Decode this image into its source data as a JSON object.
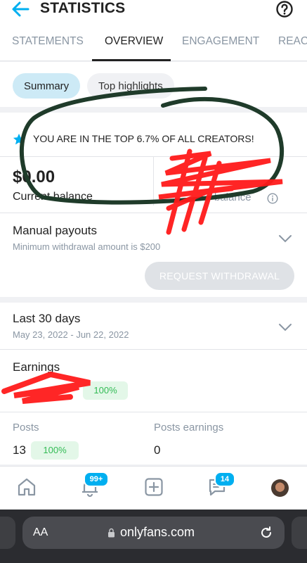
{
  "header": {
    "title": "STATISTICS",
    "back_icon": "arrow-left-icon",
    "help_icon": "question-circle-icon"
  },
  "tabs": [
    {
      "label": "STATEMENTS"
    },
    {
      "label": "OVERVIEW",
      "active": true
    },
    {
      "label": "ENGAGEMENT"
    },
    {
      "label": "REACH"
    }
  ],
  "chips": {
    "summary": "Summary",
    "top_highlights": "Top highlights"
  },
  "highlight": {
    "icon": "star-icon",
    "text": "YOU ARE IN THE TOP 6.7% OF ALL CREATORS!"
  },
  "balance": {
    "amount": "$0.00",
    "label": "Current balance",
    "pending_label": "balance",
    "info_icon": "info-icon"
  },
  "payouts": {
    "title": "Manual payouts",
    "subtitle": "Minimum withdrawal amount is $200",
    "button": "REQUEST WITHDRAWAL"
  },
  "period": {
    "title": "Last 30 days",
    "range": "May 23, 2022 - Jun 22, 2022"
  },
  "earnings": {
    "label": "Earnings",
    "percent": "100%"
  },
  "stats": {
    "posts_label": "Posts",
    "posts_value": "13",
    "posts_percent": "100%",
    "posts_earnings_label": "Posts earnings",
    "posts_earnings_value": "0"
  },
  "bottom_nav": {
    "notifications_badge": "99+",
    "messages_badge": "14",
    "icons": [
      "home-icon",
      "bell-icon",
      "add-post-icon",
      "chat-icon",
      "avatar"
    ]
  },
  "browser": {
    "aa": "AA",
    "url": "onlyfans.com"
  },
  "colors": {
    "accent": "#00aff0",
    "success": "#33bb55",
    "muted": "#8a96a3",
    "annotation_green": "#1f3b2a",
    "redaction_red": "#ff1a1a"
  }
}
